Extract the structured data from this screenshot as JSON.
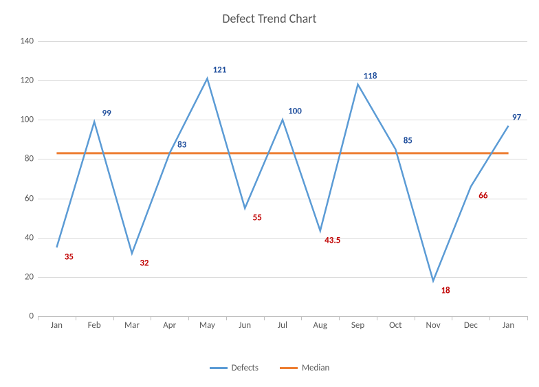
{
  "chart_data": {
    "type": "line",
    "title": "Defect Trend Chart",
    "xlabel": "",
    "ylabel": "",
    "ylim": [
      0,
      140
    ],
    "y_ticks": [
      0,
      20,
      40,
      60,
      80,
      100,
      120,
      140
    ],
    "categories": [
      "Jan",
      "Feb",
      "Mar",
      "Apr",
      "May",
      "Jun",
      "Jul",
      "Aug",
      "Sep",
      "Oct",
      "Nov",
      "Dec",
      "Jan"
    ],
    "series": [
      {
        "name": "Defects",
        "color": "#5b9bd5",
        "values": [
          35,
          99,
          32,
          83,
          121,
          55,
          100,
          43.5,
          118,
          85,
          18,
          66,
          97
        ],
        "data_labels": [
          {
            "text": "35",
            "pos": "below"
          },
          {
            "text": "99",
            "pos": "above"
          },
          {
            "text": "32",
            "pos": "below"
          },
          {
            "text": "83",
            "pos": "above"
          },
          {
            "text": "121",
            "pos": "above"
          },
          {
            "text": "55",
            "pos": "below"
          },
          {
            "text": "100",
            "pos": "above"
          },
          {
            "text": "43.5",
            "pos": "below"
          },
          {
            "text": "118",
            "pos": "above"
          },
          {
            "text": "85",
            "pos": "above"
          },
          {
            "text": "18",
            "pos": "below"
          },
          {
            "text": "66",
            "pos": "below"
          },
          {
            "text": "97",
            "pos": "above"
          }
        ]
      },
      {
        "name": "Median",
        "color": "#ed7d31",
        "values": [
          83,
          83,
          83,
          83,
          83,
          83,
          83,
          83,
          83,
          83,
          83,
          83,
          83
        ]
      }
    ]
  },
  "legend": {
    "items": [
      {
        "label": "Defects",
        "color": "#5b9bd5"
      },
      {
        "label": "Median",
        "color": "#ed7d31"
      }
    ]
  }
}
